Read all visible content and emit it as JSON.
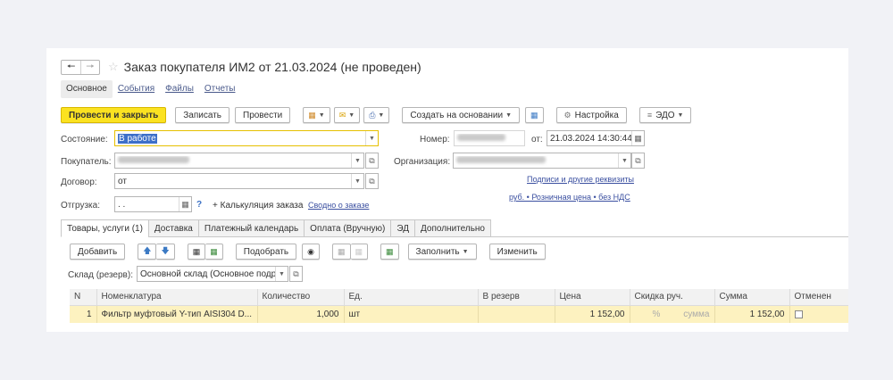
{
  "window": {
    "title": "Заказ покупателя ИМ2 от 21.03.2024 (не проведен)"
  },
  "nav": [
    "Основное",
    "События",
    "Файлы",
    "Отчеты"
  ],
  "toolbar": {
    "post_close": "Провести и закрыть",
    "save": "Записать",
    "post": "Провести",
    "create_based": "Создать на основании",
    "settings": "Настройка",
    "edo": "ЭДО"
  },
  "form": {
    "state_label": "Состояние:",
    "state_value": "В работе",
    "buyer_label": "Покупатель:",
    "contract_label": "Договор:",
    "contract_value": "от",
    "shipment_label": "Отгрузка:",
    "shipment_value": ". .",
    "question": "?",
    "calc_label": "+ Калькуляция заказа",
    "summary_link": "Сводно о заказе",
    "number_label": "Номер:",
    "date_from_label": "от:",
    "date_value": "21.03.2024 14:30:44",
    "org_label": "Организация:",
    "signatures_link": "Подписи и другие реквизиты",
    "price_link": "руб. • Розничная цена • без НДС"
  },
  "tabs": [
    "Товары, услуги (1)",
    "Доставка",
    "Платежный календарь",
    "Оплата (Вручную)",
    "ЭД",
    "Дополнительно"
  ],
  "items_toolbar": {
    "add": "Добавить",
    "pick": "Подобрать",
    "fill": "Заполнить",
    "change": "Изменить",
    "warehouse_label": "Склад (резерв):",
    "warehouse_value": "Основной склад (Основное подра:"
  },
  "table": {
    "columns": [
      "N",
      "Номенклатура",
      "Количество",
      "Ед.",
      "В резерв",
      "Цена",
      "Скидка руч.",
      "Сумма",
      "Отменен"
    ],
    "rows": [
      {
        "n": "1",
        "name": "Фильтр муфтовый Y-тип AISI304 D...",
        "qty": "1,000",
        "unit": "шт",
        "reserve": "",
        "price": "1 152,00",
        "disc_pct": "%",
        "disc_sum": "сумма",
        "sum": "1 152,00"
      }
    ]
  }
}
